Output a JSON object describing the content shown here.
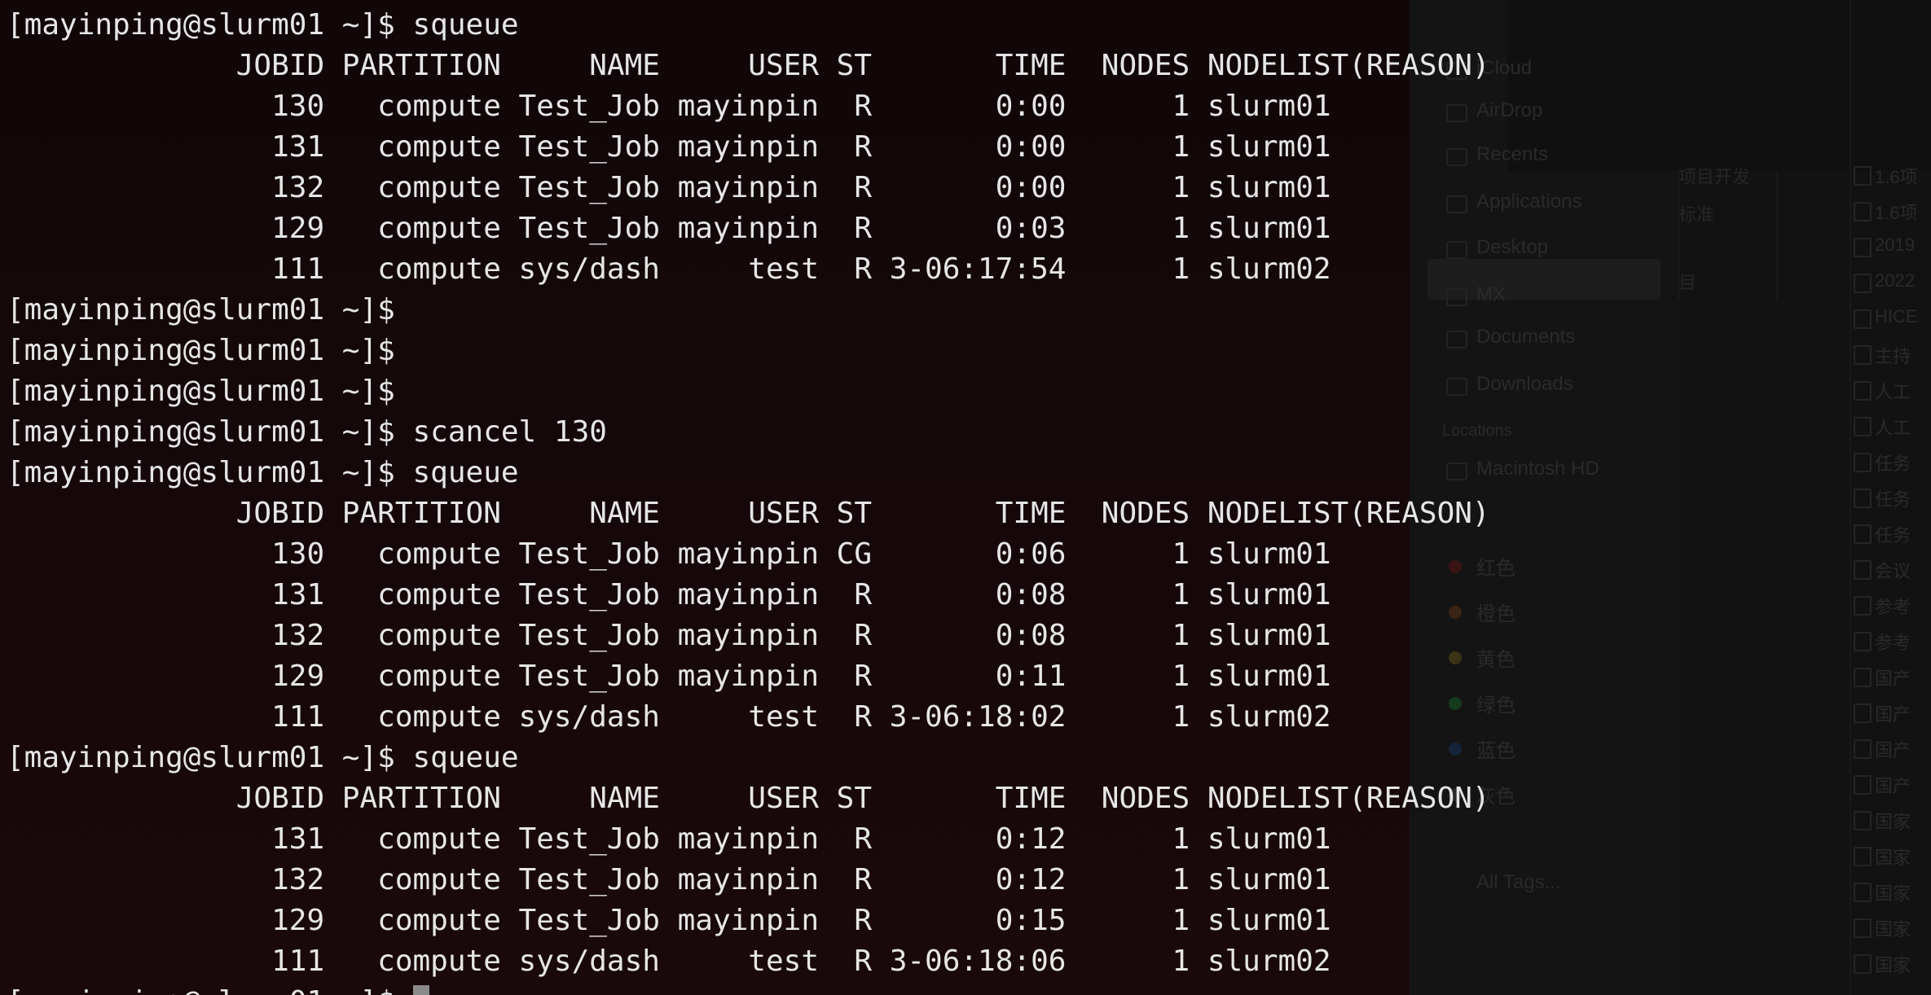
{
  "background_app": {
    "sidebar_items": [
      "iCloud",
      "AirDrop",
      "Recents",
      "Applications",
      "Desktop",
      "MX",
      "Documents",
      "Downloads"
    ],
    "locations_header": "Locations",
    "locations_items": [
      "Macintosh HD"
    ],
    "tags": [
      {
        "label": "红色",
        "color": "#3a1414"
      },
      {
        "label": "橙色",
        "color": "#3a2414"
      },
      {
        "label": "黄色",
        "color": "#3a3414"
      },
      {
        "label": "绿色",
        "color": "#163a1c"
      },
      {
        "label": "蓝色",
        "color": "#14243a"
      },
      {
        "label": "灰色",
        "color": "#2a2a2a"
      }
    ],
    "all_tags": "All Tags...",
    "middle_items": [
      "项目开发",
      "标准",
      "目"
    ],
    "right_files": [
      "1.6项",
      "1.6项",
      "2019",
      "2022",
      "HICE",
      "主持",
      "人工",
      "人工",
      "任务",
      "任务",
      "任务",
      "会议",
      "参考",
      "参考",
      "国产",
      "国产",
      "国产",
      "国产",
      "国家",
      "国家",
      "国家",
      "国家",
      "国家"
    ]
  },
  "terminal": {
    "lines": [
      "[mayinping@slurm01 ~]$ squeue",
      "             JOBID PARTITION     NAME     USER ST       TIME  NODES NODELIST(REASON)",
      "               130   compute Test_Job mayinpin  R       0:00      1 slurm01",
      "               131   compute Test_Job mayinpin  R       0:00      1 slurm01",
      "               132   compute Test_Job mayinpin  R       0:00      1 slurm01",
      "               129   compute Test_Job mayinpin  R       0:03      1 slurm01",
      "               111   compute sys/dash     test  R 3-06:17:54      1 slurm02",
      "[mayinping@slurm01 ~]$",
      "[mayinping@slurm01 ~]$",
      "[mayinping@slurm01 ~]$",
      "[mayinping@slurm01 ~]$ scancel 130",
      "[mayinping@slurm01 ~]$ squeue",
      "             JOBID PARTITION     NAME     USER ST       TIME  NODES NODELIST(REASON)",
      "               130   compute Test_Job mayinpin CG       0:06      1 slurm01",
      "               131   compute Test_Job mayinpin  R       0:08      1 slurm01",
      "               132   compute Test_Job mayinpin  R       0:08      1 slurm01",
      "               129   compute Test_Job mayinpin  R       0:11      1 slurm01",
      "               111   compute sys/dash     test  R 3-06:18:02      1 slurm02",
      "[mayinping@slurm01 ~]$ squeue",
      "             JOBID PARTITION     NAME     USER ST       TIME  NODES NODELIST(REASON)",
      "               131   compute Test_Job mayinpin  R       0:12      1 slurm01",
      "               132   compute Test_Job mayinpin  R       0:12      1 slurm01",
      "               129   compute Test_Job mayinpin  R       0:15      1 slurm01",
      "               111   compute sys/dash     test  R 3-06:18:06      1 slurm02"
    ],
    "prompt": "[mayinping@slurm01 ~]$ "
  }
}
